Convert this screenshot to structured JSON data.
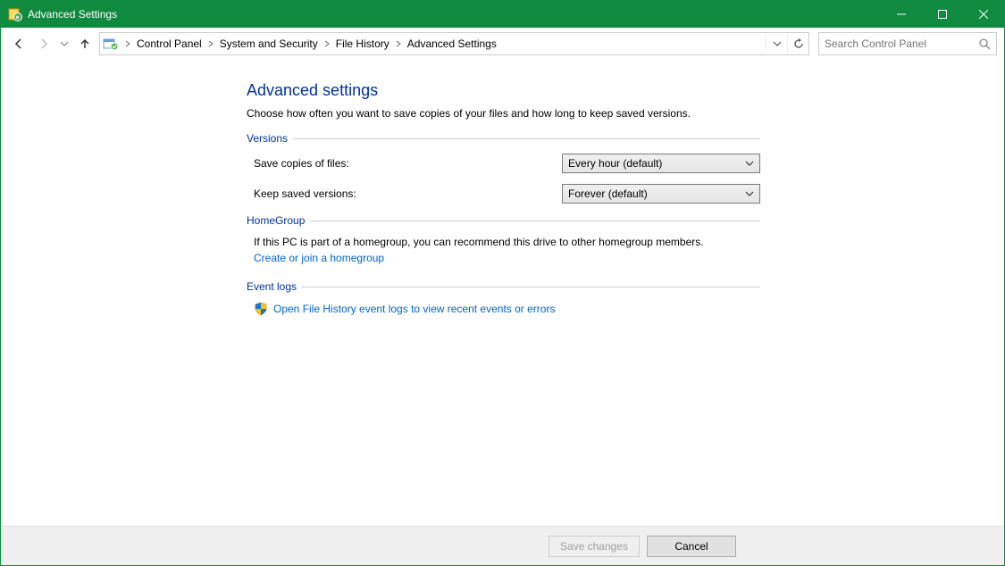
{
  "window": {
    "title": "Advanced Settings"
  },
  "breadcrumbs": {
    "b0": "Control Panel",
    "b1": "System and Security",
    "b2": "File History",
    "b3": "Advanced Settings"
  },
  "search": {
    "placeholder": "Search Control Panel"
  },
  "page": {
    "title": "Advanced settings",
    "description": "Choose how often you want to save copies of your files and how long to keep saved versions."
  },
  "sections": {
    "versions": {
      "header": "Versions",
      "save_label": "Save copies of files:",
      "save_value": "Every hour (default)",
      "keep_label": "Keep saved versions:",
      "keep_value": "Forever (default)"
    },
    "homegroup": {
      "header": "HomeGroup",
      "text": "If this PC is part of a homegroup, you can recommend this drive to other homegroup members.",
      "link": "Create or join a homegroup"
    },
    "eventlogs": {
      "header": "Event logs",
      "link": "Open File History event logs to view recent events or errors"
    }
  },
  "footer": {
    "save": "Save changes",
    "cancel": "Cancel"
  }
}
